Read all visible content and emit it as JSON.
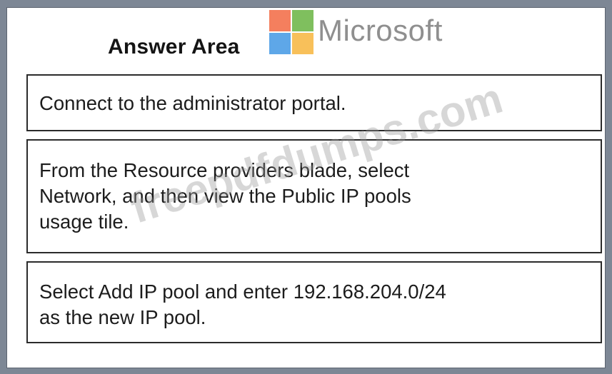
{
  "answer_area": {
    "title": "Answer Area"
  },
  "logo": {
    "brand_text": "Microsoft",
    "colors": [
      "#f47f5e",
      "#7fbf5e",
      "#5ea7e8",
      "#f8c05a"
    ]
  },
  "steps": [
    {
      "text": "Connect to the administrator portal."
    },
    {
      "line1": "From the Resource providers blade, select",
      "line2": "Network, and then view the Public IP pools",
      "line3": "usage tile."
    },
    {
      "line1": "Select Add IP pool and enter 192.168.204.0/24",
      "line2": "as the new IP pool."
    }
  ],
  "watermark": {
    "text": "freepdfdumps.com"
  }
}
